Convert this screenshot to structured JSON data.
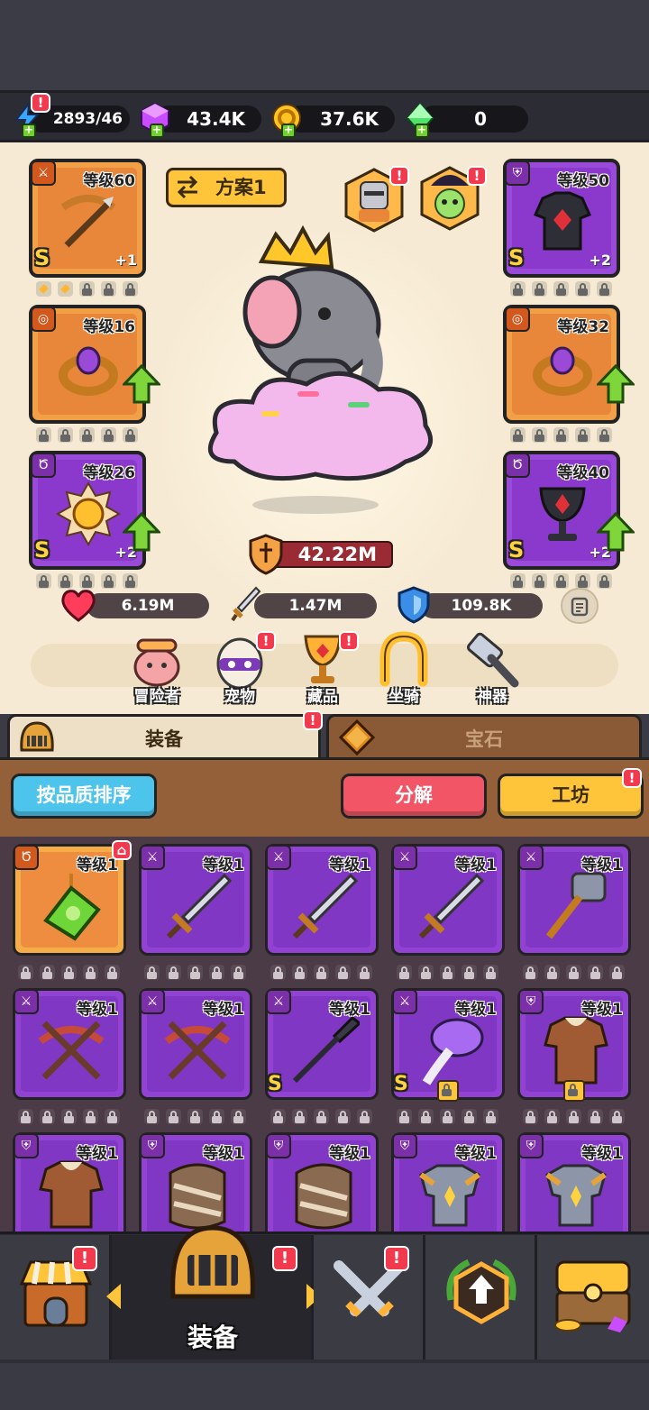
{
  "resources": {
    "energy": "2893/46",
    "gems": "43.4K",
    "coins": "37.6K",
    "crystals": "0"
  },
  "hero": {
    "scheme_label": "方案1",
    "power": "42.22M",
    "hp": "6.19M",
    "attack": "1.47M",
    "defense": "109.8K"
  },
  "equip_slots": [
    {
      "level": "等级60",
      "grade": "S",
      "plus": "+1"
    },
    {
      "level": "等级16",
      "grade": "",
      "plus": ""
    },
    {
      "level": "等级26",
      "grade": "S",
      "plus": "+2"
    },
    {
      "level": "等级50",
      "grade": "S",
      "plus": "+2"
    },
    {
      "level": "等级32",
      "grade": "",
      "plus": ""
    },
    {
      "level": "等级40",
      "grade": "S",
      "plus": "+2"
    }
  ],
  "menu": [
    {
      "label": "冒险者",
      "icon": "adventurer-icon"
    },
    {
      "label": "宠物",
      "icon": "pet-egg-icon"
    },
    {
      "label": "藏品",
      "icon": "collection-trophy-icon"
    },
    {
      "label": "坐骑",
      "icon": "mount-horseshoe-icon"
    },
    {
      "label": "神器",
      "icon": "artifact-hammer-icon"
    }
  ],
  "tabs": {
    "equipment": "装备",
    "gems": "宝石"
  },
  "actions": {
    "sort": "按品质排序",
    "dismantle": "分解",
    "workshop": "工坊"
  },
  "inventory": [
    {
      "level": "等级1",
      "grade": ""
    },
    {
      "level": "等级1",
      "grade": ""
    },
    {
      "level": "等级1",
      "grade": ""
    },
    {
      "level": "等级1",
      "grade": ""
    },
    {
      "level": "等级1",
      "grade": ""
    },
    {
      "level": "等级1",
      "grade": ""
    },
    {
      "level": "等级1",
      "grade": ""
    },
    {
      "level": "等级1",
      "grade": "S"
    },
    {
      "level": "等级1",
      "grade": "S"
    },
    {
      "level": "等级1",
      "grade": ""
    },
    {
      "level": "等级1",
      "grade": ""
    },
    {
      "level": "等级1",
      "grade": ""
    },
    {
      "level": "等级1",
      "grade": ""
    },
    {
      "level": "等级1",
      "grade": ""
    },
    {
      "level": "等级1",
      "grade": ""
    }
  ],
  "nav": {
    "active_label": "装备"
  },
  "colors": {
    "purple": "#9142d2",
    "orange": "#f5ad48",
    "gold": "#ffc53a",
    "red": "#f23a4f",
    "blue": "#4cc4ec"
  }
}
